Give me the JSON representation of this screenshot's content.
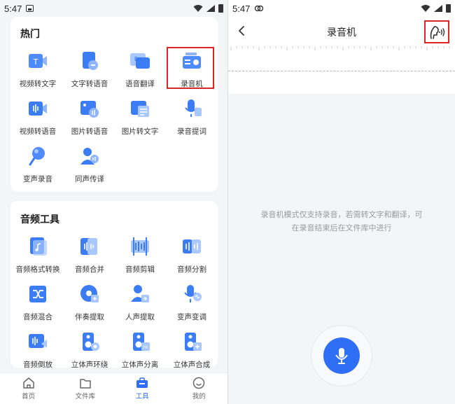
{
  "left": {
    "status": {
      "time": "5:47"
    },
    "hot": {
      "title": "热门",
      "tools": [
        {
          "label": "视频转文字",
          "icon": "video-to-text-icon"
        },
        {
          "label": "文字转语音",
          "icon": "text-to-speech-icon"
        },
        {
          "label": "语音翻译",
          "icon": "voice-translate-icon"
        },
        {
          "label": "录音机",
          "icon": "recorder-icon"
        },
        {
          "label": "视频转语音",
          "icon": "video-to-audio-icon"
        },
        {
          "label": "图片转语音",
          "icon": "image-to-speech-icon"
        },
        {
          "label": "图片转文字",
          "icon": "image-to-text-icon"
        },
        {
          "label": "录音提词",
          "icon": "teleprompter-icon"
        },
        {
          "label": "变声录音",
          "icon": "voice-changer-record-icon"
        },
        {
          "label": "同声传译",
          "icon": "simultaneous-interpret-icon"
        }
      ]
    },
    "audio": {
      "title": "音频工具",
      "tools": [
        {
          "label": "音频格式转换",
          "icon": "audio-format-icon"
        },
        {
          "label": "音频合并",
          "icon": "audio-merge-icon"
        },
        {
          "label": "音频剪辑",
          "icon": "audio-cut-icon"
        },
        {
          "label": "音频分割",
          "icon": "audio-split-icon"
        },
        {
          "label": "音频混合",
          "icon": "audio-mix-icon"
        },
        {
          "label": "伴奏提取",
          "icon": "accompaniment-extract-icon"
        },
        {
          "label": "人声提取",
          "icon": "vocal-extract-icon"
        },
        {
          "label": "变声变调",
          "icon": "pitch-shift-icon"
        },
        {
          "label": "音频倒放",
          "icon": "audio-reverse-icon"
        },
        {
          "label": "立体声环绕",
          "icon": "stereo-surround-icon"
        },
        {
          "label": "立体声分离",
          "icon": "stereo-separate-icon"
        },
        {
          "label": "立体声合成",
          "icon": "stereo-compose-icon"
        }
      ]
    },
    "tabs": [
      {
        "label": "首页",
        "icon": "home-icon"
      },
      {
        "label": "文件库",
        "icon": "folder-icon"
      },
      {
        "label": "工具",
        "icon": "toolbox-icon"
      },
      {
        "label": "我的",
        "icon": "profile-icon"
      }
    ],
    "colors": {
      "accent": "#2f6ff6",
      "highlight": "#e02424"
    }
  },
  "right": {
    "status": {
      "time": "5:47"
    },
    "title": "录音机",
    "hint": "录音机模式仅支持录音，若需转文字和翻译，可在录音结束后在文件库中进行"
  }
}
